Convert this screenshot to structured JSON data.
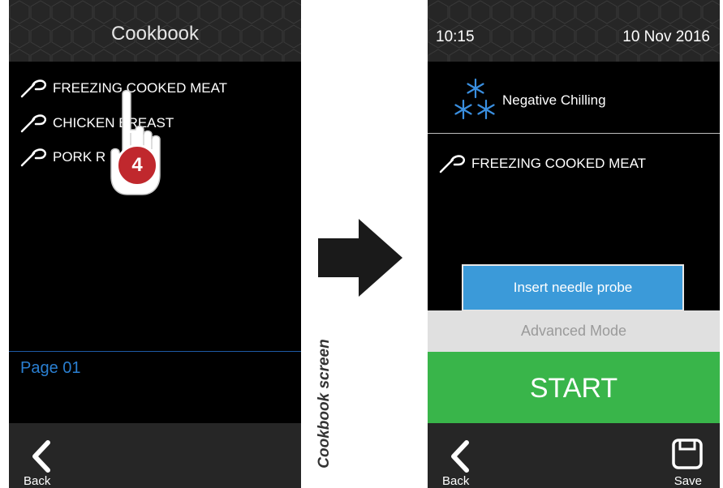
{
  "left_screen": {
    "title": "Cookbook",
    "recipes": [
      {
        "label": "FREEZING COOKED MEAT"
      },
      {
        "label": "CHICKEN BREAST"
      },
      {
        "label": "PORK R"
      }
    ],
    "page_label": "Page 01",
    "step_badge": "4",
    "back_label": "Back"
  },
  "caption": "Cookbook screen",
  "right_screen": {
    "time": "10:15",
    "date": "10  Nov  2016",
    "mode_label": "Negative Chilling",
    "selected_recipe": "FREEZING COOKED MEAT",
    "probe_button": "Insert needle probe",
    "advanced_button": "Advanced Mode",
    "start_button": "START",
    "back_label": "Back",
    "save_label": "Save"
  },
  "colors": {
    "screen_bg": "#000000",
    "header_bg": "#262626",
    "accent_blue": "#3b9ad9",
    "page_blue": "#2a7fd1",
    "start_green": "#39b54a",
    "advanced_gray": "#e0e0e0",
    "badge_red": "#c0282d"
  },
  "icons": {
    "probe": "needle-probe-icon",
    "snowflake": "snowflake-icon",
    "back": "chevron-left-icon",
    "save": "floppy-disk-icon",
    "hand": "pointing-hand-icon",
    "arrow": "arrow-right-icon"
  }
}
